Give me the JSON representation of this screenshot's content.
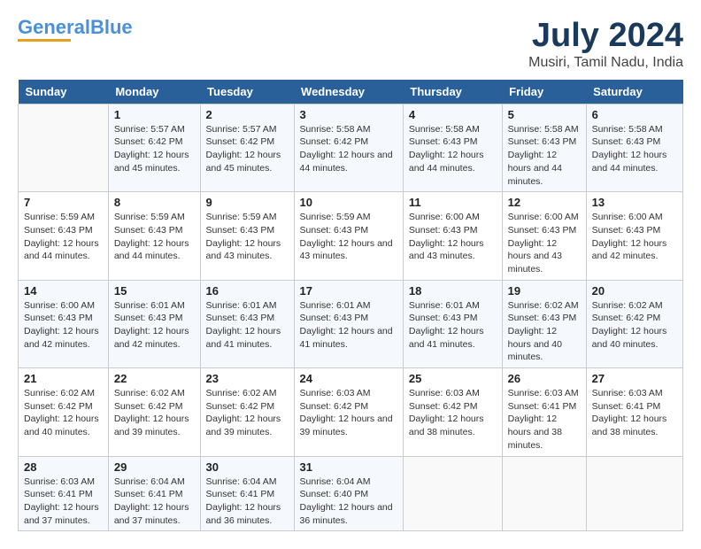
{
  "header": {
    "logo_line1": "General",
    "logo_line2": "Blue",
    "title": "July 2024",
    "subtitle": "Musiri, Tamil Nadu, India"
  },
  "days_of_week": [
    "Sunday",
    "Monday",
    "Tuesday",
    "Wednesday",
    "Thursday",
    "Friday",
    "Saturday"
  ],
  "weeks": [
    [
      {
        "day": "",
        "info": ""
      },
      {
        "day": "1",
        "info": "Sunrise: 5:57 AM\nSunset: 6:42 PM\nDaylight: 12 hours\nand 45 minutes."
      },
      {
        "day": "2",
        "info": "Sunrise: 5:57 AM\nSunset: 6:42 PM\nDaylight: 12 hours\nand 45 minutes."
      },
      {
        "day": "3",
        "info": "Sunrise: 5:58 AM\nSunset: 6:42 PM\nDaylight: 12 hours\nand 44 minutes."
      },
      {
        "day": "4",
        "info": "Sunrise: 5:58 AM\nSunset: 6:43 PM\nDaylight: 12 hours\nand 44 minutes."
      },
      {
        "day": "5",
        "info": "Sunrise: 5:58 AM\nSunset: 6:43 PM\nDaylight: 12 hours\nand 44 minutes."
      },
      {
        "day": "6",
        "info": "Sunrise: 5:58 AM\nSunset: 6:43 PM\nDaylight: 12 hours\nand 44 minutes."
      }
    ],
    [
      {
        "day": "7",
        "info": "Sunrise: 5:59 AM\nSunset: 6:43 PM\nDaylight: 12 hours\nand 44 minutes."
      },
      {
        "day": "8",
        "info": "Sunrise: 5:59 AM\nSunset: 6:43 PM\nDaylight: 12 hours\nand 44 minutes."
      },
      {
        "day": "9",
        "info": "Sunrise: 5:59 AM\nSunset: 6:43 PM\nDaylight: 12 hours\nand 43 minutes."
      },
      {
        "day": "10",
        "info": "Sunrise: 5:59 AM\nSunset: 6:43 PM\nDaylight: 12 hours\nand 43 minutes."
      },
      {
        "day": "11",
        "info": "Sunrise: 6:00 AM\nSunset: 6:43 PM\nDaylight: 12 hours\nand 43 minutes."
      },
      {
        "day": "12",
        "info": "Sunrise: 6:00 AM\nSunset: 6:43 PM\nDaylight: 12 hours\nand 43 minutes."
      },
      {
        "day": "13",
        "info": "Sunrise: 6:00 AM\nSunset: 6:43 PM\nDaylight: 12 hours\nand 42 minutes."
      }
    ],
    [
      {
        "day": "14",
        "info": "Sunrise: 6:00 AM\nSunset: 6:43 PM\nDaylight: 12 hours\nand 42 minutes."
      },
      {
        "day": "15",
        "info": "Sunrise: 6:01 AM\nSunset: 6:43 PM\nDaylight: 12 hours\nand 42 minutes."
      },
      {
        "day": "16",
        "info": "Sunrise: 6:01 AM\nSunset: 6:43 PM\nDaylight: 12 hours\nand 41 minutes."
      },
      {
        "day": "17",
        "info": "Sunrise: 6:01 AM\nSunset: 6:43 PM\nDaylight: 12 hours\nand 41 minutes."
      },
      {
        "day": "18",
        "info": "Sunrise: 6:01 AM\nSunset: 6:43 PM\nDaylight: 12 hours\nand 41 minutes."
      },
      {
        "day": "19",
        "info": "Sunrise: 6:02 AM\nSunset: 6:43 PM\nDaylight: 12 hours\nand 40 minutes."
      },
      {
        "day": "20",
        "info": "Sunrise: 6:02 AM\nSunset: 6:42 PM\nDaylight: 12 hours\nand 40 minutes."
      }
    ],
    [
      {
        "day": "21",
        "info": "Sunrise: 6:02 AM\nSunset: 6:42 PM\nDaylight: 12 hours\nand 40 minutes."
      },
      {
        "day": "22",
        "info": "Sunrise: 6:02 AM\nSunset: 6:42 PM\nDaylight: 12 hours\nand 39 minutes."
      },
      {
        "day": "23",
        "info": "Sunrise: 6:02 AM\nSunset: 6:42 PM\nDaylight: 12 hours\nand 39 minutes."
      },
      {
        "day": "24",
        "info": "Sunrise: 6:03 AM\nSunset: 6:42 PM\nDaylight: 12 hours\nand 39 minutes."
      },
      {
        "day": "25",
        "info": "Sunrise: 6:03 AM\nSunset: 6:42 PM\nDaylight: 12 hours\nand 38 minutes."
      },
      {
        "day": "26",
        "info": "Sunrise: 6:03 AM\nSunset: 6:41 PM\nDaylight: 12 hours\nand 38 minutes."
      },
      {
        "day": "27",
        "info": "Sunrise: 6:03 AM\nSunset: 6:41 PM\nDaylight: 12 hours\nand 38 minutes."
      }
    ],
    [
      {
        "day": "28",
        "info": "Sunrise: 6:03 AM\nSunset: 6:41 PM\nDaylight: 12 hours\nand 37 minutes."
      },
      {
        "day": "29",
        "info": "Sunrise: 6:04 AM\nSunset: 6:41 PM\nDaylight: 12 hours\nand 37 minutes."
      },
      {
        "day": "30",
        "info": "Sunrise: 6:04 AM\nSunset: 6:41 PM\nDaylight: 12 hours\nand 36 minutes."
      },
      {
        "day": "31",
        "info": "Sunrise: 6:04 AM\nSunset: 6:40 PM\nDaylight: 12 hours\nand 36 minutes."
      },
      {
        "day": "",
        "info": ""
      },
      {
        "day": "",
        "info": ""
      },
      {
        "day": "",
        "info": ""
      }
    ]
  ]
}
